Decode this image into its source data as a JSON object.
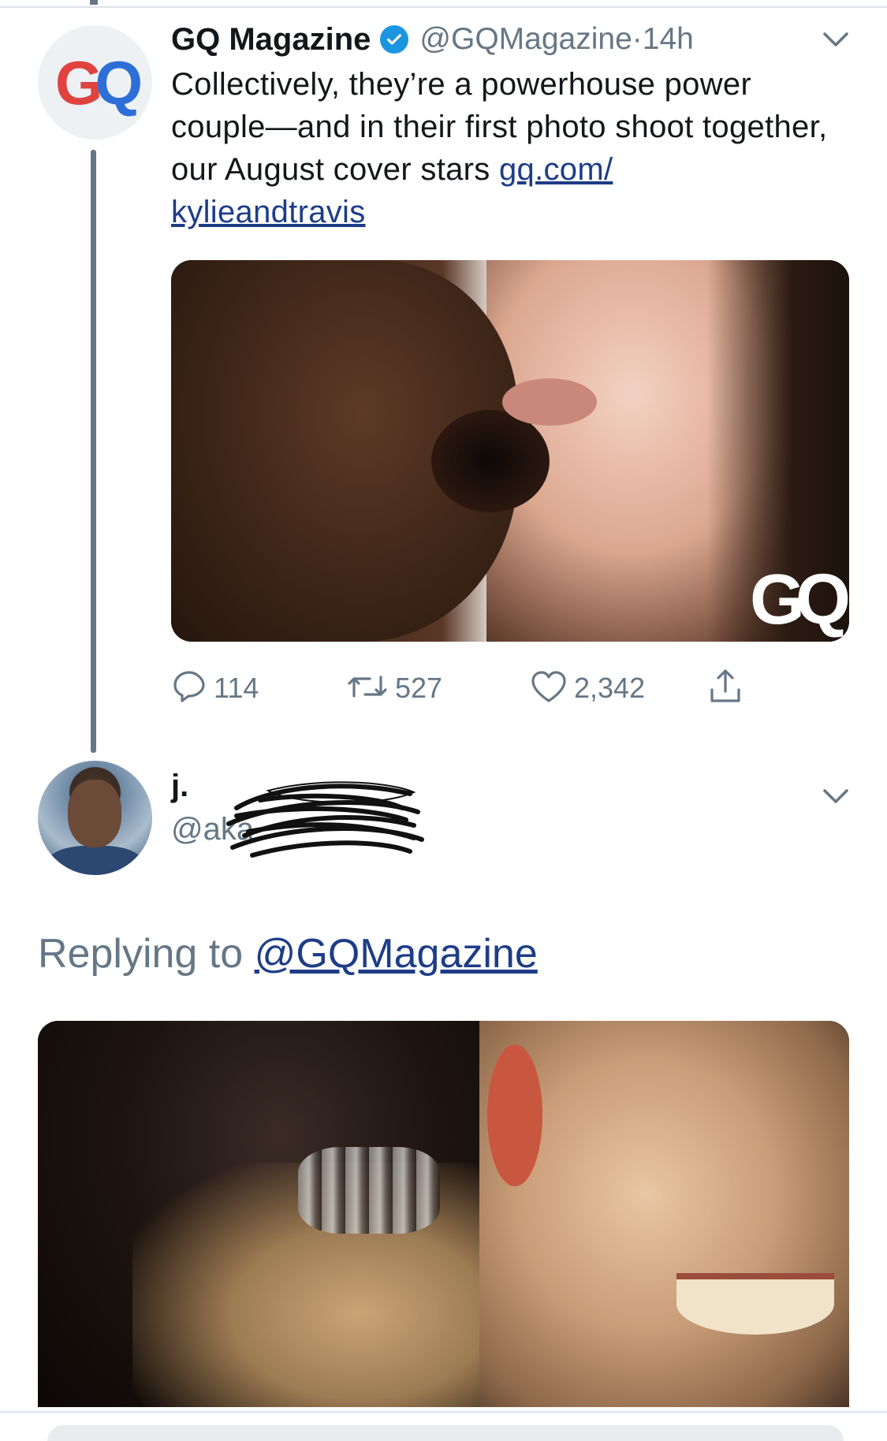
{
  "tweet": {
    "display_name": "GQ Magazine",
    "handle": "@GQMagazine",
    "separator": " · ",
    "time": "14h",
    "avatar_logo": "GQ",
    "text": "Collectively, they’re a powerhouse power couple—and in their first photo shoot together, our August cover stars ",
    "link_text": "gq.com/\nkylieandtravis",
    "media_watermark": "GQ",
    "actions": {
      "reply_count": "114",
      "retweet_count": "527",
      "like_count": "2,342"
    }
  },
  "reply": {
    "display_name": "j.",
    "handle": "@aka",
    "replying_label": "Replying to ",
    "replying_mention": "@GQMagazine"
  },
  "icons": {
    "verified": "verified-badge-icon",
    "chevron": "chevron-down-icon",
    "reply": "reply-icon",
    "retweet": "retweet-icon",
    "like": "heart-icon",
    "share": "share-icon"
  },
  "colors": {
    "link": "#1d3d87",
    "muted": "#657786",
    "verified": "#1b95e0",
    "gq_red": "#e0433f",
    "gq_blue": "#2d6fd7"
  }
}
